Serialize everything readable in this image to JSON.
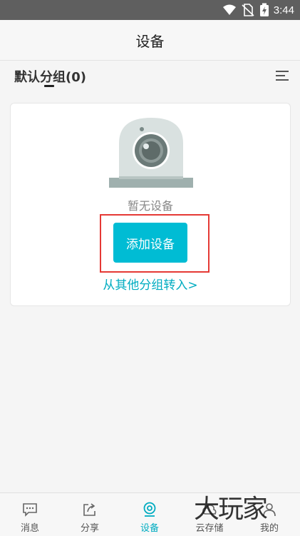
{
  "status_bar": {
    "time": "3:44",
    "icons": [
      "wifi-icon",
      "no-sim-icon",
      "battery-charging-icon"
    ]
  },
  "header": {
    "title": "设备"
  },
  "group": {
    "title": "默认分组(0)",
    "menu_icon": "menu-lines-icon"
  },
  "device_card": {
    "illustration": "camera-icon",
    "empty_text": "暂无设备",
    "add_button_label": "添加设备",
    "move_link": "从其他分组转入>"
  },
  "bottom_nav": {
    "items": [
      {
        "label": "消息",
        "icon": "message-icon"
      },
      {
        "label": "分享",
        "icon": "share-icon"
      },
      {
        "label": "设备",
        "icon": "device-icon",
        "active": true
      },
      {
        "label": "云存储",
        "icon": "cloud-storage-icon"
      },
      {
        "label": "我的",
        "icon": "profile-icon"
      }
    ]
  },
  "colors": {
    "accent": "#00bcd4",
    "highlight": "#e53935",
    "status_bar": "#5f5f5f"
  },
  "watermark": {
    "text": "大玩家"
  }
}
